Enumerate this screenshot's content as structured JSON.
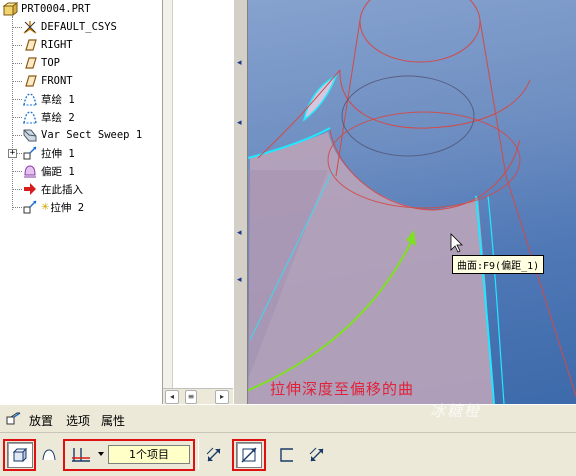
{
  "tree": {
    "root": "PRT0004.PRT",
    "items": [
      {
        "label": "DEFAULT_CSYS",
        "icon": "csys-icon"
      },
      {
        "label": "RIGHT",
        "icon": "datum-plane-icon"
      },
      {
        "label": "TOP",
        "icon": "datum-plane-icon"
      },
      {
        "label": "FRONT",
        "icon": "datum-plane-icon"
      },
      {
        "label": "草绘 1",
        "icon": "sketch-icon"
      },
      {
        "label": "草绘 2",
        "icon": "sketch-icon"
      },
      {
        "label": "Var Sect Sweep 1",
        "icon": "sweep-icon"
      },
      {
        "label": "拉伸 1",
        "icon": "extrude-icon"
      },
      {
        "label": "偏距 1",
        "icon": "offset-icon"
      },
      {
        "label": "在此插入",
        "icon": "insert-here-arrow-icon"
      },
      {
        "label": "拉伸 2",
        "icon": "extrude-icon"
      }
    ]
  },
  "viewport": {
    "tooltip": "曲面:F9(偏距_1)",
    "annotation": "拉伸深度至偏移的曲",
    "watermark": "冰糖橙"
  },
  "dashboard": {
    "tabs": [
      "放置",
      "选项",
      "属性"
    ],
    "collector_value": "1个项目"
  },
  "colors": {
    "annotation": "#e0223a",
    "surface_edge": "#20e8ff",
    "red_highlight": "#dd1111",
    "green_arrow": "#7fe021"
  }
}
